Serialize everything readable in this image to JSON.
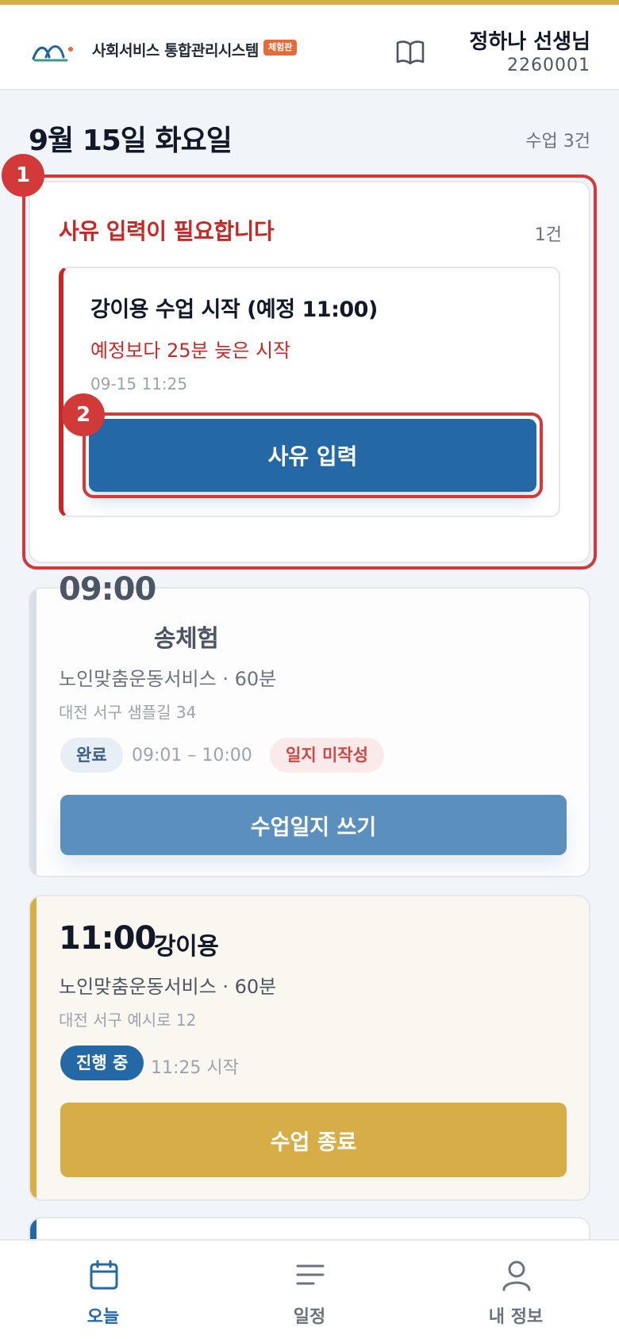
{
  "colors": {
    "accent_blue": "#2468a5",
    "alert_red": "#c62828",
    "gold": "#d7ad48",
    "background": "#f1f5f9"
  },
  "header": {
    "app_title": "사회서비스 통합관리시스템",
    "badge": "체험판",
    "book_icon": "book-icon",
    "user_name": "정하나 선생님",
    "user_id": "2260001"
  },
  "summary": {
    "date": "9월 15일 화요일",
    "class_count": "수업 3건"
  },
  "alert": {
    "marker": "1",
    "title": "사유 입력이 필요합니다",
    "count": "1건",
    "item": {
      "title": "강이용 수업 시작 (예정 11:00)",
      "subtitle": "예정보다 25분 늦은 시작",
      "timestamp": "09-15 11:25",
      "marker": "2",
      "button": "사유 입력"
    }
  },
  "classes": [
    {
      "time": "09:00",
      "name": "송체험",
      "service": "노인맞춤운동서비스 · 60분",
      "address": "대전 서구 샘플길 34",
      "status": "완료",
      "status_detail": "09:01 – 10:00",
      "log_badge": "일지 미작성",
      "action": "수업일지 쓰기"
    },
    {
      "time": "11:00",
      "name": "강이용",
      "service": "노인맞춤운동서비스 · 60분",
      "address": "대전 서구 예시로 12",
      "status": "진행 중",
      "status_detail": "11:25 시작",
      "action": "수업 종료"
    }
  ],
  "nav": {
    "today": "오늘",
    "schedule": "일정",
    "profile": "내 정보",
    "today_icon": "calendar-icon",
    "schedule_icon": "list-icon",
    "profile_icon": "person-icon"
  }
}
